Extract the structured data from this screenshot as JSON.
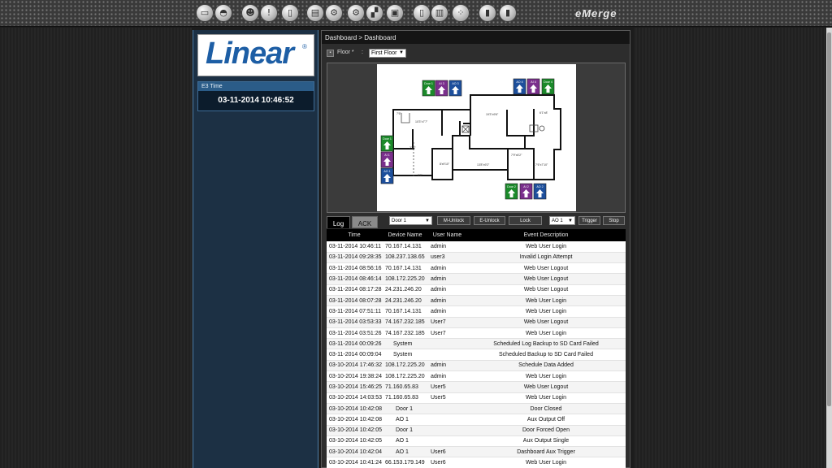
{
  "toolbar": {
    "icons": [
      {
        "name": "monitor-icon",
        "glyph": "▭"
      },
      {
        "name": "camera-icon",
        "glyph": "◓"
      },
      {
        "name": "user-icon",
        "glyph": "☻"
      },
      {
        "name": "alert-icon",
        "glyph": "!"
      },
      {
        "name": "door-icon",
        "glyph": "▯"
      },
      {
        "name": "id-card-icon",
        "glyph": "▤"
      },
      {
        "name": "settings-icon",
        "glyph": "⚙"
      },
      {
        "name": "network-icon",
        "glyph": "⚙"
      },
      {
        "name": "floor-plan-icon",
        "glyph": "▞"
      },
      {
        "name": "save-icon",
        "glyph": "▣"
      },
      {
        "name": "document-icon",
        "glyph": "▯"
      },
      {
        "name": "report-icon",
        "glyph": "▥"
      },
      {
        "name": "grid-icon",
        "glyph": "⁘"
      },
      {
        "name": "exit-door-icon",
        "glyph": "▮"
      },
      {
        "name": "logout-icon",
        "glyph": "▮"
      }
    ],
    "brand": "eMerge"
  },
  "sidebar": {
    "logo_text": "Linear",
    "logo_mark": "®",
    "time_title": "E3 Time",
    "time_value": "03-11-2014 10:46:52"
  },
  "main": {
    "breadcrumb": "Dashboard > Dashboard",
    "floor_label": "Floor *",
    "floor_colon": ":",
    "floor_value": "First Floor",
    "floor_options_arrow": "▼",
    "tabs": {
      "log": "Log",
      "ack": "ACK"
    },
    "door_select": "Door 1",
    "m_unlock": "M-Unlock",
    "e_unlock": "E-Unlock",
    "lock": "Lock",
    "ao_select": "AO 1",
    "trigger": "Trigger",
    "stop": "Stop"
  },
  "map": {
    "devices": [
      {
        "label": "Door 1",
        "color": "#1b8a2a"
      },
      {
        "label": "AI 3",
        "color": "#7a2f8c"
      },
      {
        "label": "AO 3",
        "color": "#1d4f9c"
      },
      {
        "label": "AO 4",
        "color": "#1d4f9c"
      },
      {
        "label": "AI 4",
        "color": "#7a2f8c"
      },
      {
        "label": "Door 4",
        "color": "#1b8a2a"
      },
      {
        "label": "Door 1",
        "color": "#1b8a2a"
      },
      {
        "label": "AI 1",
        "color": "#7a2f8c"
      },
      {
        "label": "AO 1",
        "color": "#1d4f9c"
      },
      {
        "label": "Door 2",
        "color": "#1b8a2a"
      },
      {
        "label": "AI 2",
        "color": "#7a2f8c"
      },
      {
        "label": "AO 2",
        "color": "#1d4f9c"
      }
    ],
    "room_labels": [
      "7'6\"",
      "10'3\"x7'7\"",
      "19'3\"x9'6\"",
      "6'1\"x8'",
      "23'3\"",
      "8'x9'10\"",
      "13'8\"x9'2\"",
      "7'9\"x6'2\"",
      "7'6\"x7'10\"",
      "8'6\""
    ]
  },
  "log": {
    "columns": [
      "Time",
      "Device Name",
      "User Name",
      "Event Description"
    ],
    "rows": [
      [
        "03-11-2014 10:46:11",
        "70.167.14.131",
        "admin",
        "Web User Login"
      ],
      [
        "03-11-2014 09:28:35",
        "108.237.138.65",
        "user3",
        "Invalid Login Attempt"
      ],
      [
        "03-11-2014 08:56:16",
        "70.167.14.131",
        "admin",
        "Web User Logout"
      ],
      [
        "03-11-2014 08:46:14",
        "108.172.225.20",
        "admin",
        "Web User Logout"
      ],
      [
        "03-11-2014 08:17:28",
        "24.231.246.20",
        "admin",
        "Web User Logout"
      ],
      [
        "03-11-2014 08:07:28",
        "24.231.246.20",
        "admin",
        "Web User Login"
      ],
      [
        "03-11-2014 07:51:11",
        "70.167.14.131",
        "admin",
        "Web User Login"
      ],
      [
        "03-11-2014 03:53:33",
        "74.167.232.185",
        "User7",
        "Web User Logout"
      ],
      [
        "03-11-2014 03:51:26",
        "74.167.232.185",
        "User7",
        "Web User Login"
      ],
      [
        "03-11-2014 00:09:26",
        "System",
        "",
        "Scheduled Log Backup to SD Card Failed"
      ],
      [
        "03-11-2014 00:09:04",
        "System",
        "",
        "Scheduled Backup to SD Card Failed"
      ],
      [
        "03-10-2014 17:46:32",
        "108.172.225.20",
        "admin",
        "Schedule Data Added"
      ],
      [
        "03-10-2014 19:38:24",
        "108.172.225.20",
        "admin",
        "Web User Login"
      ],
      [
        "03-10-2014 15:46:25",
        "71.160.65.83",
        "User5",
        "Web User Logout"
      ],
      [
        "03-10-2014 14:03:53",
        "71.160.65.83",
        "User5",
        "Web User Login"
      ],
      [
        "03-10-2014 10:42:08",
        "Door 1",
        "",
        "Door Closed"
      ],
      [
        "03-10-2014 10:42:08",
        "AO 1",
        "",
        "Aux Output Off"
      ],
      [
        "03-10-2014 10:42:05",
        "Door 1",
        "",
        "Door Forced Open"
      ],
      [
        "03-10-2014 10:42:05",
        "AO 1",
        "",
        "Aux Output Single"
      ],
      [
        "03-10-2014 10:42:04",
        "AO 1",
        "User6",
        "Dashboard Aux Trigger"
      ],
      [
        "03-10-2014 10:41:24",
        "66.153.179.149",
        "User6",
        "Web User Login"
      ]
    ]
  }
}
